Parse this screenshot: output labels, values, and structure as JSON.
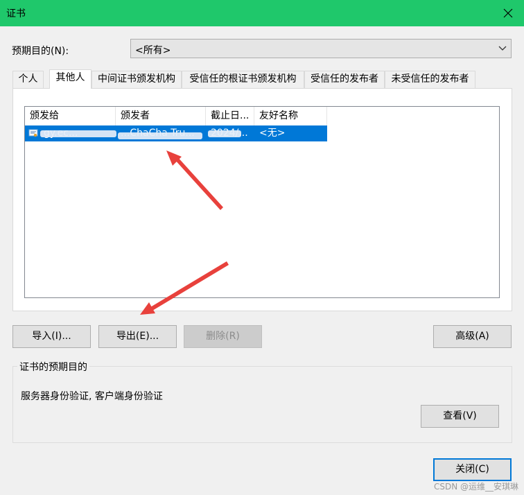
{
  "window": {
    "title": "证书"
  },
  "purpose": {
    "label": "预期目的(N):",
    "value": "<所有>"
  },
  "tabs": [
    {
      "label": "个人"
    },
    {
      "label": "其他人"
    },
    {
      "label": "中间证书颁发机构"
    },
    {
      "label": "受信任的根证书颁发机构"
    },
    {
      "label": "受信任的发布者"
    },
    {
      "label": "未受信任的发布者"
    }
  ],
  "list": {
    "columns": [
      "颁发给",
      "颁发者",
      "截止日...",
      "友好名称"
    ],
    "rows": [
      {
        "issued_to": "gy.ec...",
        "issued_by": "...ChaCha Tru...",
        "expiry": "2024/...",
        "friendly_name": "<无>"
      }
    ]
  },
  "buttons": {
    "import": "导入(I)...",
    "export": "导出(E)...",
    "delete": "删除(R)",
    "advanced": "高级(A)",
    "view": "查看(V)",
    "close": "关闭(C)"
  },
  "purpose_group": {
    "title": "证书的预期目的",
    "text": "服务器身份验证, 客户端身份验证"
  },
  "watermark": "CSDN @运维__安琪琳",
  "colors": {
    "titlebar": "#1fc86b",
    "selection": "#0078d7",
    "annotation_arrow": "#e8413c"
  }
}
